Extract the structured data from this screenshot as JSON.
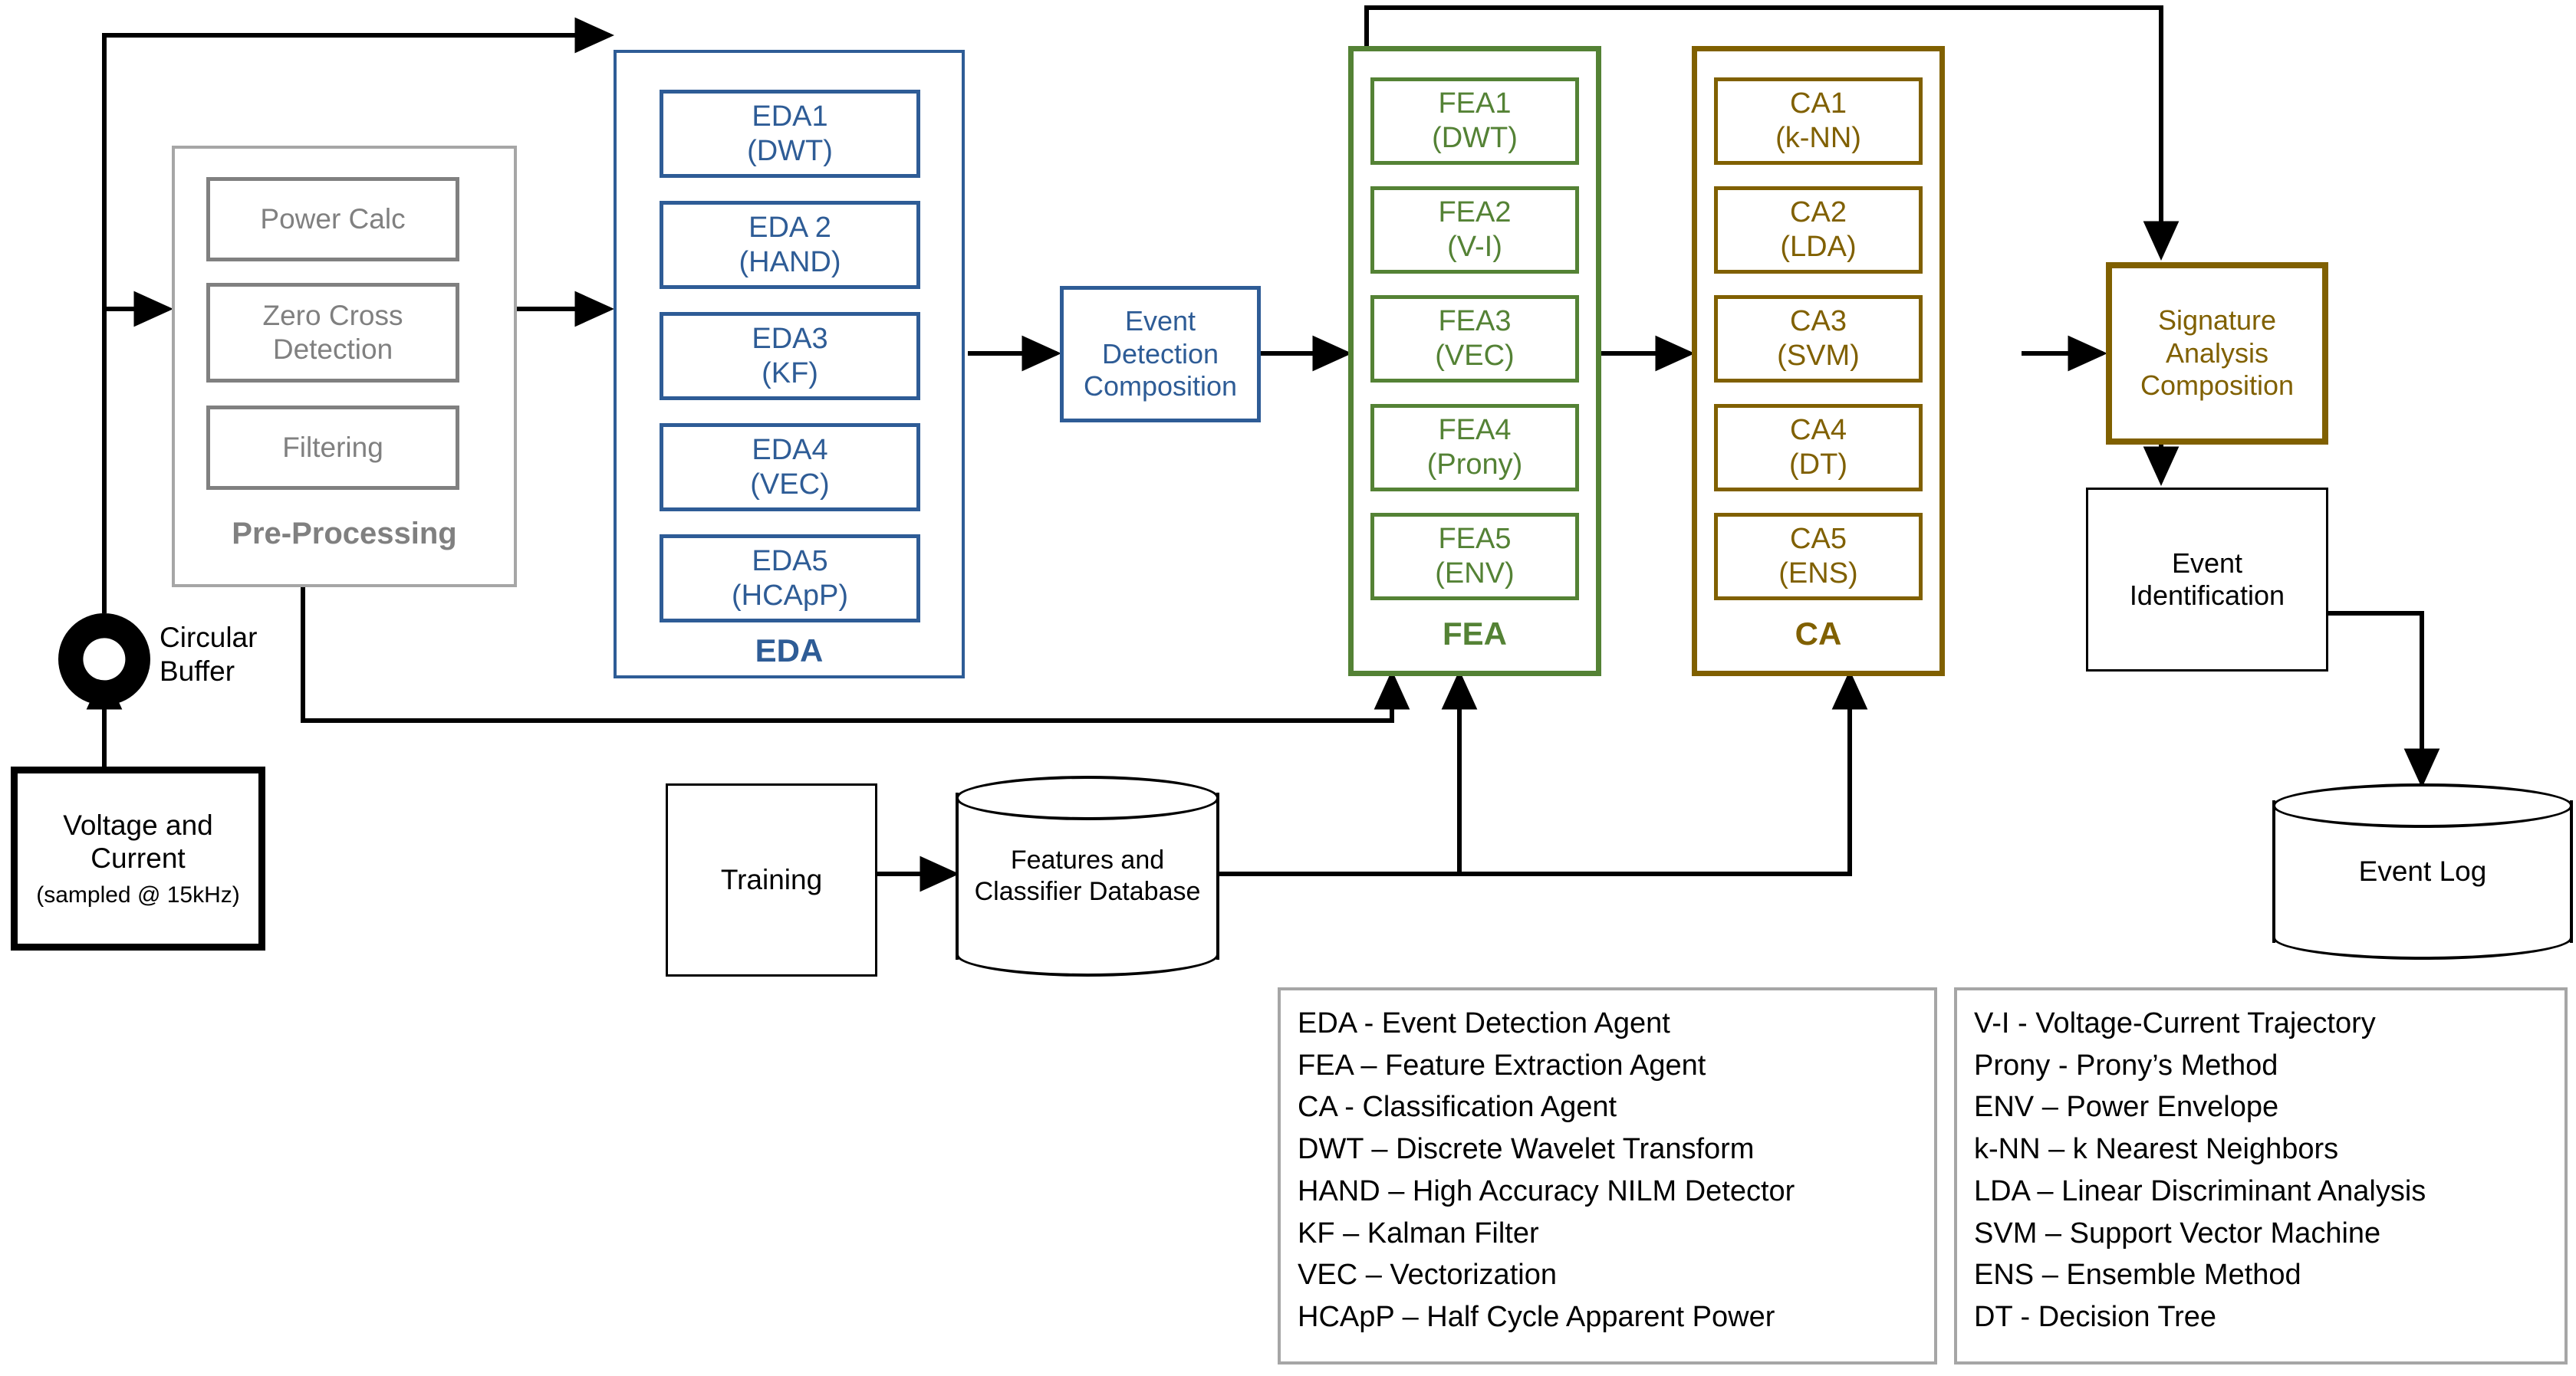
{
  "colors": {
    "blue": "#2E5C96",
    "green": "#548235",
    "gold": "#806000",
    "grey": "#808080",
    "black": "#000000"
  },
  "source": {
    "line1": "Voltage and",
    "line2": "Current",
    "line3": "(sampled @ 15kHz)"
  },
  "circular_buffer": {
    "line1": "Circular",
    "line2": "Buffer"
  },
  "preprocessing": {
    "title": "Pre-Processing",
    "blocks": [
      {
        "label": "Power Calc"
      },
      {
        "label": "Zero Cross\nDetection",
        "line1": "Zero Cross",
        "line2": "Detection"
      },
      {
        "label": "Filtering"
      }
    ]
  },
  "eda": {
    "title": "EDA",
    "agents": [
      {
        "name": "EDA1",
        "method": "(DWT)"
      },
      {
        "name": "EDA 2",
        "method": "(HAND)"
      },
      {
        "name": "EDA3",
        "method": "(KF)"
      },
      {
        "name": "EDA4",
        "method": "(VEC)"
      },
      {
        "name": "EDA5",
        "method": "(HCApP)"
      }
    ]
  },
  "event_detection_composition": {
    "line1": "Event",
    "line2": "Detection",
    "line3": "Composition"
  },
  "fea": {
    "title": "FEA",
    "agents": [
      {
        "name": "FEA1",
        "method": "(DWT)"
      },
      {
        "name": "FEA2",
        "method": "(V-I)"
      },
      {
        "name": "FEA3",
        "method": "(VEC)"
      },
      {
        "name": "FEA4",
        "method": "(Prony)"
      },
      {
        "name": "FEA5",
        "method": "(ENV)"
      }
    ]
  },
  "ca": {
    "title": "CA",
    "agents": [
      {
        "name": "CA1",
        "method": "(k-NN)"
      },
      {
        "name": "CA2",
        "method": "(LDA)"
      },
      {
        "name": "CA3",
        "method": "(SVM)"
      },
      {
        "name": "CA4",
        "method": "(DT)"
      },
      {
        "name": "CA5",
        "method": "(ENS)"
      }
    ]
  },
  "signature_analysis_composition": {
    "line1": "Signature",
    "line2": "Analysis",
    "line3": "Composition"
  },
  "event_identification": {
    "line1": "Event",
    "line2": "Identification"
  },
  "event_log": {
    "label": "Event Log"
  },
  "training": {
    "label": "Training"
  },
  "features_database": {
    "line1": "Features and",
    "line2": "Classifier Database"
  },
  "legend_left": {
    "items": [
      "EDA  - Event Detection Agent",
      "FEA – Feature Extraction Agent",
      "CA  - Classification Agent",
      "DWT – Discrete Wavelet Transform",
      "HAND – High Accuracy NILM Detector",
      "KF – Kalman Filter",
      "VEC – Vectorization",
      "HCApP – Half Cycle Apparent Power"
    ]
  },
  "legend_right": {
    "items": [
      "V-I  - Voltage-Current Trajectory",
      "Prony - Prony’s Method",
      "ENV – Power Envelope",
      "k-NN – k Nearest Neighbors",
      "LDA – Linear Discriminant Analysis",
      "SVM – Support Vector Machine",
      "ENS – Ensemble Method",
      "DT  - Decision Tree"
    ]
  }
}
